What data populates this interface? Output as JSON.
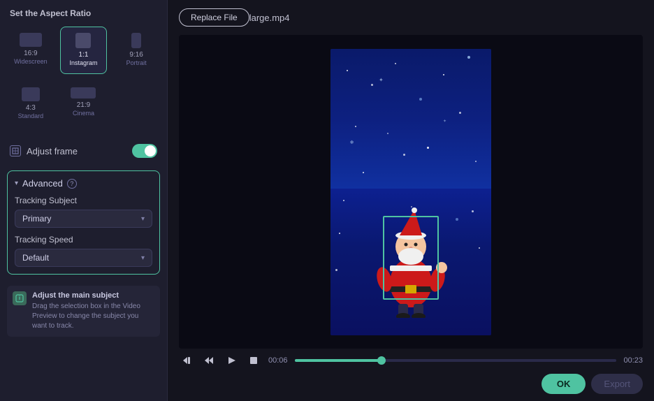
{
  "sidebar": {
    "title": "Set the Aspect Ratio",
    "aspect_ratios": [
      {
        "id": "16:9",
        "label": "16:9",
        "sublabel": "Widescreen",
        "selected": false
      },
      {
        "id": "1:1",
        "label": "1:1",
        "sublabel": "Instagram",
        "selected": true
      },
      {
        "id": "9:16",
        "label": "9:16",
        "sublabel": "Portrait",
        "selected": false
      },
      {
        "id": "4:3",
        "label": "4:3",
        "sublabel": "Standard",
        "selected": false
      },
      {
        "id": "21:9",
        "label": "21:9",
        "sublabel": "Cinema",
        "selected": false
      }
    ],
    "adjust_frame_label": "Adjust frame",
    "advanced": {
      "title": "Advanced",
      "help_tooltip": "?",
      "tracking_subject_label": "Tracking Subject",
      "tracking_subject_value": "Primary",
      "tracking_speed_label": "Tracking Speed",
      "tracking_speed_value": "Default"
    },
    "info": {
      "title": "Adjust the main subject",
      "description": "Drag the selection box in the Video Preview to change the subject you want to track."
    }
  },
  "main": {
    "replace_file_btn": "Replace File",
    "file_name": "large.mp4",
    "time_current": "00:06",
    "time_total": "00:23",
    "progress_percent": 27,
    "ok_btn": "OK",
    "export_btn": "Export"
  },
  "icons": {
    "chevron_down": "▾",
    "chevron_left": "◂",
    "play_prev": "⏮",
    "play": "▶",
    "play_back": "⏭",
    "stop": "■",
    "adjust_frame": "⊞"
  }
}
